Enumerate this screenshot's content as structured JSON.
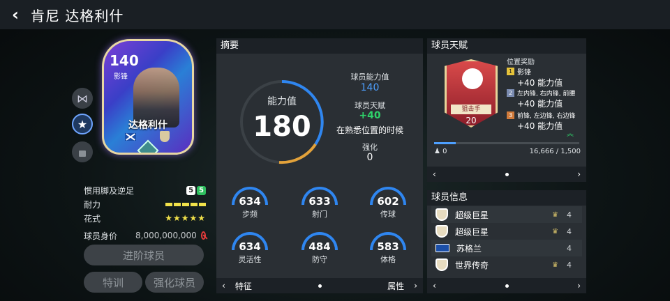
{
  "header": {
    "back_icon": "back-arrow-icon",
    "title": "肯尼 达格利什"
  },
  "card": {
    "rating": "140",
    "position": "影锋",
    "name": "达格利什"
  },
  "side_buttons": [
    {
      "icon": "share-icon",
      "glyph": "⋈"
    },
    {
      "icon": "star-icon",
      "glyph": "★"
    },
    {
      "icon": "lock-icon",
      "glyph": "🔒"
    }
  ],
  "player_props": {
    "foot_label": "惯用脚及逆足",
    "foot_left": "5",
    "foot_right": "5",
    "stamina_label": "耐力",
    "skill_label": "花式",
    "skill_stars": "★★★★★",
    "value_label": "球员身价",
    "value": "8,000,000,000"
  },
  "buttons": {
    "advance": "进阶球员",
    "train": "特训",
    "enhance": "强化球员"
  },
  "summary": {
    "title": "摘要",
    "ovr_label": "能力值",
    "ovr": "180",
    "ability_label": "球员能力值",
    "ability": "140",
    "talent_label": "球员天赋",
    "talent_bonus": "+40",
    "talent_desc": "在熟悉位置的时候",
    "enhance_label": "强化",
    "enhance": "0",
    "stats": [
      {
        "value": "634",
        "label": "步频"
      },
      {
        "value": "633",
        "label": "射门"
      },
      {
        "value": "602",
        "label": "传球"
      },
      {
        "value": "634",
        "label": "灵活性"
      },
      {
        "value": "484",
        "label": "防守"
      },
      {
        "value": "583",
        "label": "体格"
      }
    ],
    "footer_left": "特征",
    "footer_right": "属性"
  },
  "talent": {
    "title": "球员天赋",
    "badge_label": "狙击手",
    "badge_level": "20",
    "bonus_title": "位置奖励",
    "bonuses": [
      {
        "num": "1",
        "positions": "影锋",
        "bonus": "+40 能力值",
        "color": "#e6c33a"
      },
      {
        "num": "2",
        "positions": "左内锋, 右内锋, 前腰",
        "bonus": "+40 能力值",
        "color": "#7a8bb0"
      },
      {
        "num": "3",
        "positions": "前锋, 左边锋, 右边锋",
        "bonus": "+40 能力值",
        "color": "#d07a3a"
      }
    ],
    "progress": 0.15,
    "left_count": "0",
    "exp": "16,666 / 1,500"
  },
  "player_info": {
    "title": "球员信息",
    "rows": [
      {
        "name": "超级巨星",
        "level": "4"
      },
      {
        "name": "超级巨星",
        "level": "4"
      },
      {
        "name": "苏格兰",
        "level": "4"
      },
      {
        "name": "世界传奇",
        "level": "4"
      }
    ]
  }
}
